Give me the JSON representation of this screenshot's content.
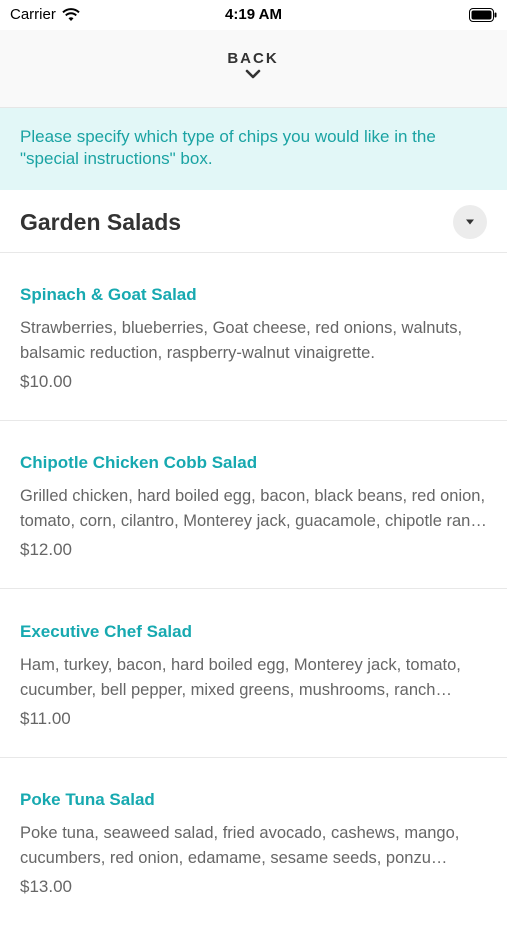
{
  "status_bar": {
    "carrier": "Carrier",
    "time": "4:19 AM"
  },
  "header": {
    "back_label": "BACK"
  },
  "notice": {
    "text": "Please specify which type of chips you would like in the \"special instructions\" box."
  },
  "section": {
    "title": "Garden Salads"
  },
  "items": [
    {
      "name": "Spinach & Goat Salad",
      "description": "Strawberries, blueberries, Goat cheese, red onions, walnuts, balsamic reduction, raspberry-walnut vinaigrette.",
      "price": "$10.00"
    },
    {
      "name": "Chipotle Chicken Cobb Salad",
      "description": "Grilled chicken, hard boiled egg, bacon, black beans, red onion, tomato, corn, cilantro, Monterey jack, guacamole, chipotle ranch dressing.",
      "price": "$12.00"
    },
    {
      "name": "Executive Chef Salad",
      "description": "Ham, turkey, bacon, hard boiled egg, Monterey jack, tomato, cucumber, bell pepper, mixed greens, mushrooms, ranch dressing.",
      "price": "$11.00"
    },
    {
      "name": "Poke Tuna Salad",
      "description": "Poke tuna, seaweed salad, fried avocado, cashews, mango, cucumbers, red onion, edamame, sesame seeds, ponzu dressing.",
      "price": "$13.00"
    }
  ],
  "colors": {
    "accent": "#17a9b0",
    "notice_bg": "#e2f7f7"
  }
}
